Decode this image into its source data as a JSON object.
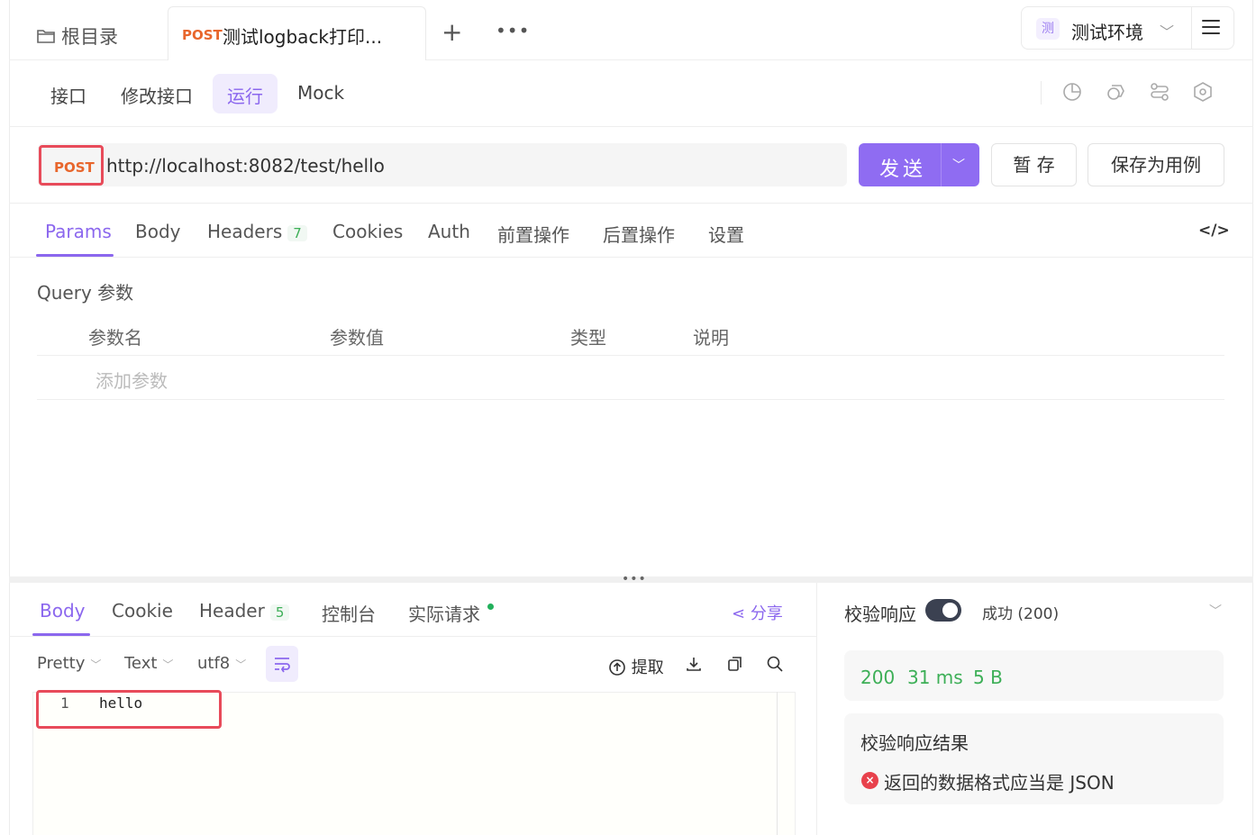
{
  "tabs": {
    "root_label": "根目录",
    "active_method": "POST",
    "active_name": "测试logback打印...",
    "add_symbol": "+",
    "more_symbol": "•••"
  },
  "env": {
    "icon_char": "测",
    "label": "测试环境",
    "chevron": "﹀"
  },
  "subnav": {
    "items": [
      "接口",
      "修改接口",
      "运行",
      "Mock"
    ],
    "active_index": 2
  },
  "request": {
    "method": "POST",
    "url": "http://localhost:8082/test/hello",
    "send_label": "发送",
    "send_chevron": "﹀",
    "save_temp_label": "暂 存",
    "save_case_label": "保存为用例"
  },
  "request_tabs": {
    "params": "Params",
    "body": "Body",
    "headers": "Headers",
    "headers_count": "7",
    "cookies": "Cookies",
    "auth": "Auth",
    "pre_ops": "前置操作",
    "post_ops": "后置操作",
    "settings": "设置",
    "code_icon": "</>"
  },
  "query": {
    "title": "Query 参数",
    "columns": [
      "参数名",
      "参数值",
      "类型",
      "说明"
    ],
    "add_placeholder": "添加参数"
  },
  "splitter_dots": "•••",
  "response_tabs": {
    "body": "Body",
    "cookie": "Cookie",
    "header": "Header",
    "header_count": "5",
    "console": "控制台",
    "actual_request": "实际请求",
    "share": "分享"
  },
  "response_options": {
    "format": "Pretty",
    "type": "Text",
    "encoding": "utf8",
    "extract": "提取",
    "chevron": "﹀"
  },
  "editor": {
    "line_number": "1",
    "content": "hello"
  },
  "validation": {
    "label": "校验响应",
    "enabled": true,
    "status_label": "成功 (200)",
    "chevron": "﹀",
    "status_code": "200",
    "time": "31 ms",
    "size": "5 B",
    "result_title": "校验响应结果",
    "error_icon": "×",
    "error_message": "返回的数据格式应当是 JSON"
  },
  "colors": {
    "accent": "#8b67ee",
    "method_post": "#e8662c",
    "success": "#3daf57",
    "error": "#e8414c",
    "highlight": "#e84b5a"
  }
}
